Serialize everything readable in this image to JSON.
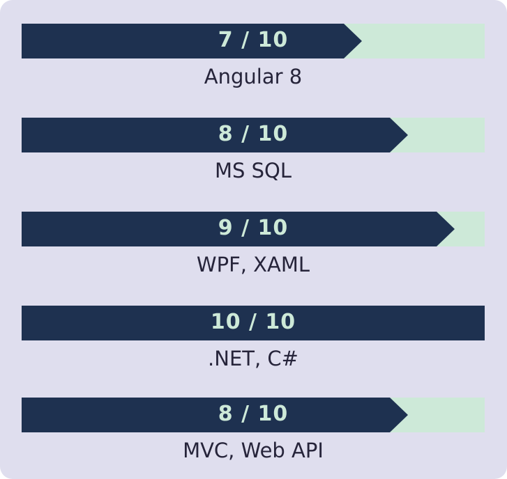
{
  "colors": {
    "background": "#dfdeee",
    "bar_fill": "#1e3150",
    "bar_track": "#cde9d8",
    "value_text": "#cde9d8",
    "label_text": "#26243a"
  },
  "skills": [
    {
      "value_text": "7 / 10",
      "level": 0.7,
      "name": "Angular 8"
    },
    {
      "value_text": "8 / 10",
      "level": 0.8,
      "name": "MS SQL"
    },
    {
      "value_text": "9 / 10",
      "level": 0.9,
      "name": "WPF, XAML"
    },
    {
      "value_text": "10 / 10",
      "level": 1.0,
      "name": ".NET, C#"
    },
    {
      "value_text": "8 / 10",
      "level": 0.8,
      "name": "MVC, Web API"
    }
  ]
}
